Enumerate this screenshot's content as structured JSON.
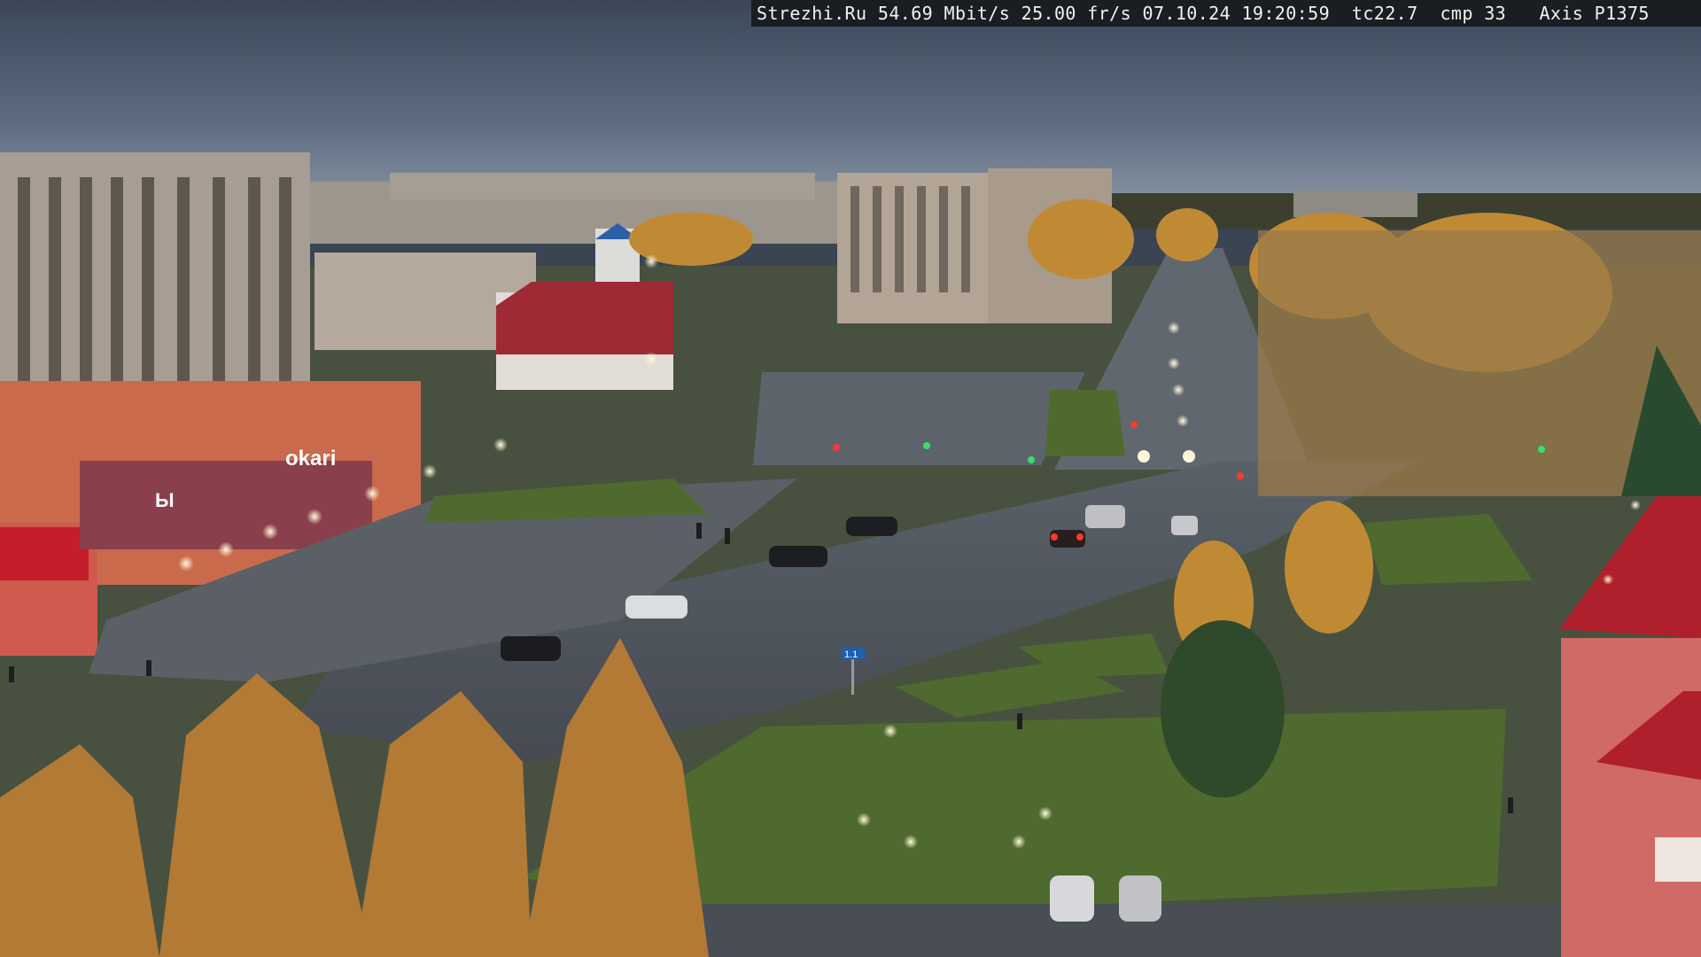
{
  "camera_overlay": {
    "site": "Strezhi.Ru",
    "bitrate": "54.69 Mbit/s",
    "framerate": "25.00 fr/s",
    "date": "07.10.24",
    "time": "19:20:59",
    "tc": "tc22.7",
    "cmp": "cmp 33",
    "camera_model": "Axis P1375"
  },
  "signs": {
    "shop_sign_left": "Ы",
    "shop_sign_right": "okari",
    "road_sign": "1.1"
  },
  "colors": {
    "sky_top": "#3d4a5c",
    "sky_bottom": "#7d8a9c",
    "asphalt": "#4a4f55",
    "grass": "#4e6a2e",
    "autumn_foliage": "#c0802c",
    "brick_red": "#c4332e"
  }
}
